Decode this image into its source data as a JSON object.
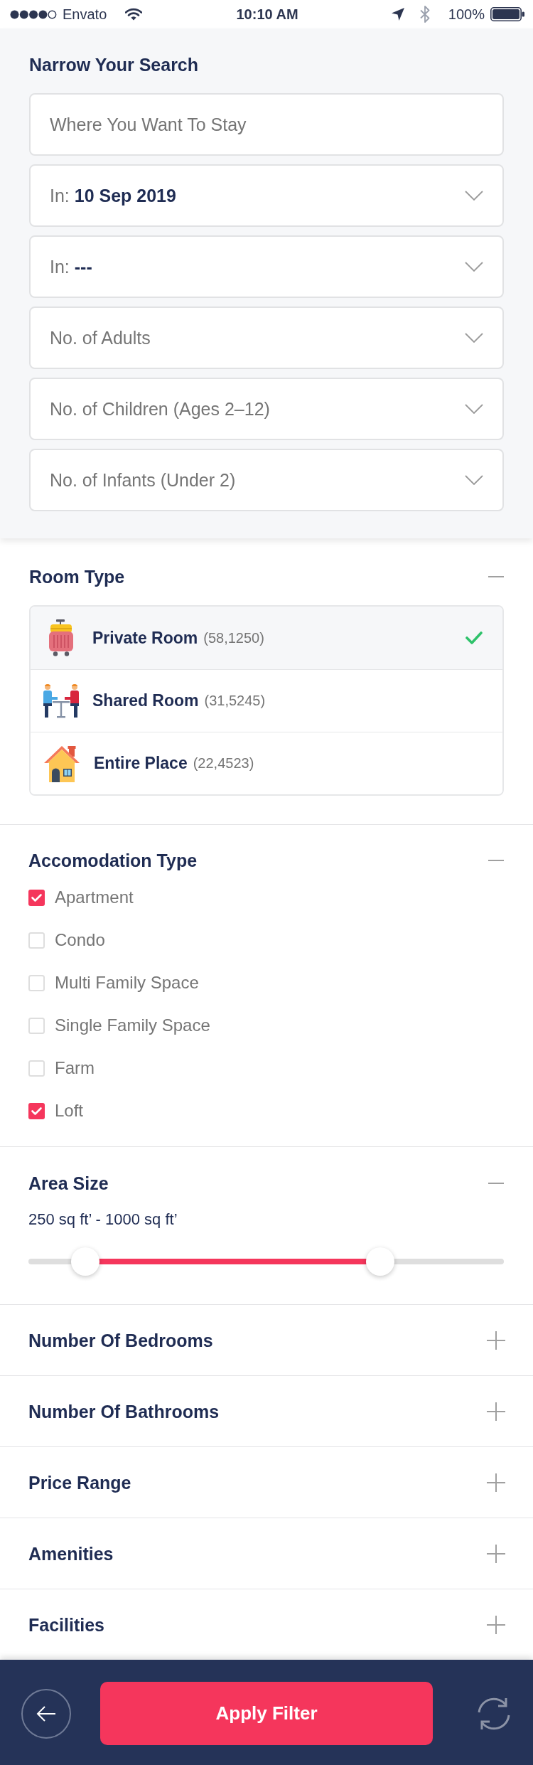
{
  "status_bar": {
    "carrier": "Envato",
    "time": "10:10 AM",
    "battery": "100%"
  },
  "search_panel": {
    "title": "Narrow Your Search",
    "fields": [
      {
        "kind": "text",
        "placeholder": "Where You Want To Stay"
      },
      {
        "kind": "select",
        "value": "In: **10 Sep 2019**"
      },
      {
        "kind": "select",
        "value": "In: **---**"
      },
      {
        "kind": "select",
        "placeholder": "No. of Adults"
      },
      {
        "kind": "select",
        "placeholder": "No. of Children (Ages 2–12)"
      },
      {
        "kind": "select",
        "placeholder": "No. of Infants (Under 2)"
      }
    ]
  },
  "sections": [
    {
      "kind": "room_type",
      "title": "Room Type",
      "expanded": true,
      "options": [
        {
          "name": "Private Room",
          "count": "(58,1250)",
          "selected": true
        },
        {
          "name": "Shared Room",
          "count": "(31,5245)",
          "selected": false
        },
        {
          "name": "Entire Place",
          "count": "(22,4523)",
          "selected": false
        }
      ]
    },
    {
      "kind": "checklist",
      "title": "Accomodation Type",
      "expanded": true,
      "options": [
        {
          "label": "Apartment",
          "checked": true
        },
        {
          "label": "Condo",
          "checked": false
        },
        {
          "label": "Multi Family Space",
          "checked": false
        },
        {
          "label": "Single Family Space",
          "checked": false
        },
        {
          "label": "Farm",
          "checked": false
        },
        {
          "label": "Loft",
          "checked": true
        }
      ]
    },
    {
      "kind": "range",
      "title": "Area Size",
      "expanded": true,
      "range": "250 sq ft’ - 1000 sq ft’",
      "thumbs": [
        {
          "level": 0.12
        },
        {
          "level": 0.74
        }
      ]
    },
    {
      "title": "Number Of Bedrooms",
      "expanded": false
    },
    {
      "title": "Number Of Bathrooms",
      "expanded": false
    },
    {
      "title": "Price Range",
      "expanded": false
    },
    {
      "title": "Amenities",
      "expanded": false
    },
    {
      "title": "Facilities",
      "expanded": false
    }
  ],
  "footer": {
    "apply_label": "Apply Filter"
  }
}
